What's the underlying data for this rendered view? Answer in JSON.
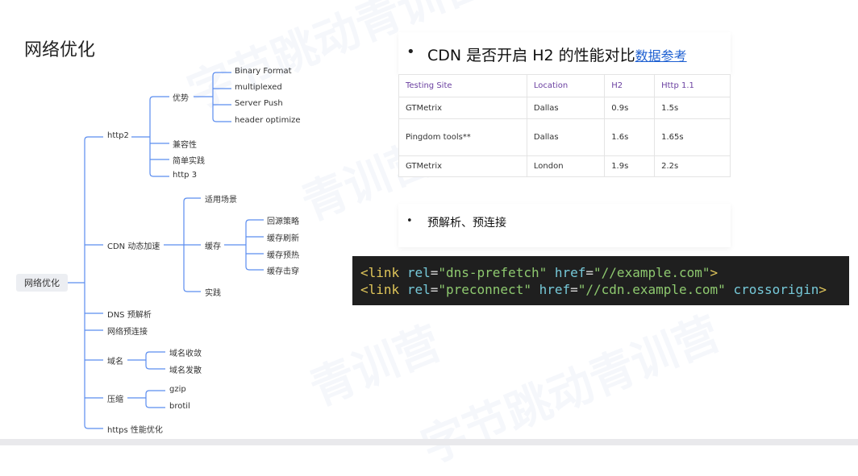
{
  "slide": {
    "title": "网络优化"
  },
  "mindmap": {
    "root": "网络优化",
    "branches": [
      {
        "label": "http2",
        "children": [
          {
            "label": "优势",
            "children": [
              "Binary Format",
              "multiplexed",
              "Server Push",
              "header optimize"
            ]
          },
          {
            "label": "兼容性"
          },
          {
            "label": "简单实践"
          },
          {
            "label": "http 3"
          }
        ]
      },
      {
        "label": "CDN 动态加速",
        "children": [
          {
            "label": "适用场景"
          },
          {
            "label": "缓存",
            "children": [
              "回源策略",
              "缓存刷新",
              "缓存预热",
              "缓存击穿"
            ]
          },
          {
            "label": "实践"
          }
        ]
      },
      {
        "label": "DNS 预解析"
      },
      {
        "label": "网络预连接"
      },
      {
        "label": "域名",
        "children": [
          {
            "label": "域名收敛"
          },
          {
            "label": "域名发散"
          }
        ]
      },
      {
        "label": "压缩",
        "children": [
          {
            "label": "gzip"
          },
          {
            "label": "brotil"
          }
        ]
      },
      {
        "label": "https 性能优化"
      }
    ]
  },
  "comparison": {
    "bullet": "•",
    "heading": "CDN 是否开启 H2 的性能对比",
    "link": "数据参考",
    "columns": [
      "Testing Site",
      "Location",
      "H2",
      "Http 1.1"
    ],
    "rows": [
      [
        "GTMetrix",
        "Dallas",
        "0.9s",
        "1.5s"
      ],
      [
        "Pingdom tools**",
        "Dallas",
        "1.6s",
        "1.65s"
      ],
      [
        "GTMetrix",
        "London",
        "1.9s",
        "2.2s"
      ]
    ]
  },
  "preconnect": {
    "bullet": "•",
    "text": "预解析、预连接"
  },
  "code": {
    "line1": {
      "open": "<link",
      "attr1": "rel",
      "val1": "\"dns-prefetch\"",
      "attr2": "href",
      "val2": "\"//example.com\"",
      "close": ">"
    },
    "line2": {
      "open": "<link",
      "attr1": "rel",
      "val1": "\"preconnect\"",
      "attr2": "href",
      "val2": "\"//cdn.example.com\"",
      "extra": "crossorigin",
      "close": ">"
    }
  },
  "watermarks": [
    "字节跳动青训营",
    "青训营",
    "字节跳动",
    "青训营",
    "字节跳动青训营"
  ],
  "colors": {
    "connector": "#5b8def",
    "table_header": "#6a3fa0",
    "link": "#1d5fd1",
    "code_bg": "#1f1f1f"
  }
}
